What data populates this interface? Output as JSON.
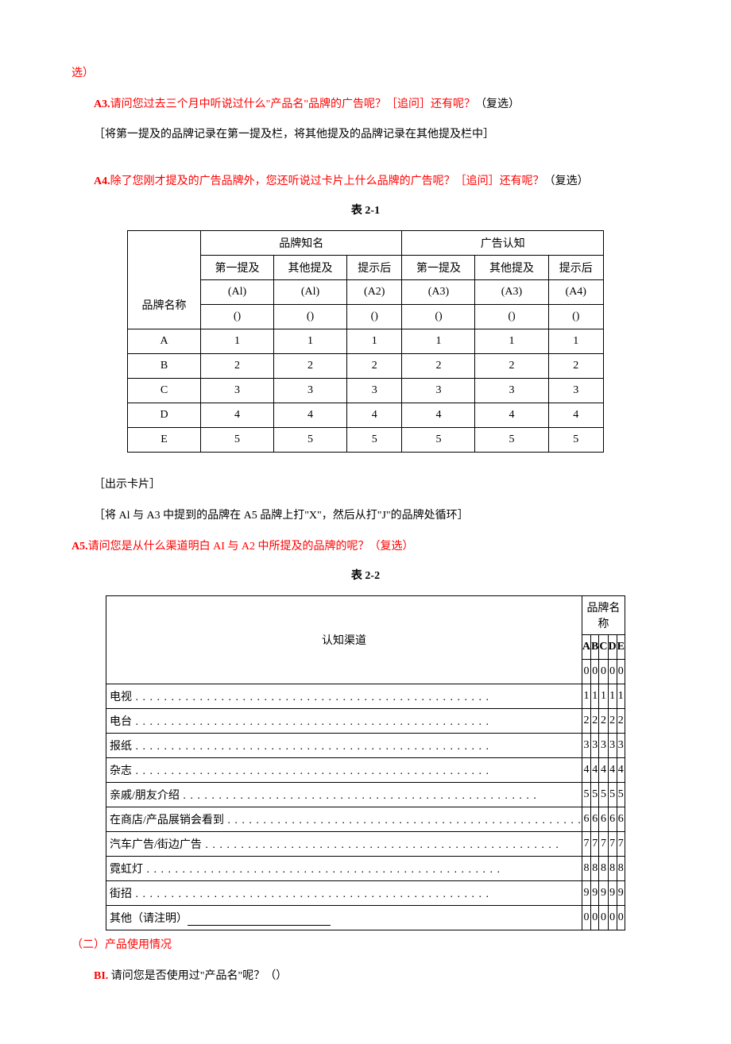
{
  "top_fragment": "选）",
  "q_a3": {
    "label": "A3.",
    "text": "请问您过去三个月中听说过什么\"产品名\"品牌的广告呢？［追问］还有呢？",
    "suffix": "（复选）",
    "note": "［将第一提及的品牌记录在第一提及栏，将其他提及的品牌记录在其他提及栏中］"
  },
  "q_a4": {
    "label": "A4.",
    "text": "除了您刚才提及的广告品牌外，您还听说过卡片上什么品牌的广告呢？［追问］还有呢？",
    "suffix": "（复选）"
  },
  "table1": {
    "caption": "表 2-1",
    "group_headers": [
      "品牌知名",
      "广告认知"
    ],
    "sub_headers": [
      "第一提及",
      "其他提及",
      "提示后",
      "第一提及",
      "其他提及",
      "提示后"
    ],
    "code_row": [
      "(Al)",
      "(Al)",
      "(A2)",
      "(A3)",
      "(A3)",
      "(A4)"
    ],
    "paren_row": [
      "()",
      "()",
      "()",
      "()",
      "()",
      "()"
    ],
    "row_label": "品牌名称",
    "rows": [
      {
        "name": "A",
        "v": [
          "1",
          "1",
          "1",
          "1",
          "1",
          "1"
        ]
      },
      {
        "name": "B",
        "v": [
          "2",
          "2",
          "2",
          "2",
          "2",
          "2"
        ]
      },
      {
        "name": "C",
        "v": [
          "3",
          "3",
          "3",
          "3",
          "3",
          "3"
        ]
      },
      {
        "name": "D",
        "v": [
          "4",
          "4",
          "4",
          "4",
          "4",
          "4"
        ]
      },
      {
        "name": "E",
        "v": [
          "5",
          "5",
          "5",
          "5",
          "5",
          "5"
        ]
      }
    ]
  },
  "mid_notes": {
    "n1": "［出示卡片］",
    "n2": "［将 Al 与 A3 中提到的品牌在 A5 品牌上打\"X\"，然后从打\"J\"的品牌处循环］"
  },
  "q_a5": {
    "label": "A5.",
    "text": "请问您是从什么渠道明白 AI 与 A2 中所提及的品牌的呢？（复选）"
  },
  "table2": {
    "caption": "表 2-2",
    "left_header": "认知渠道",
    "right_header": "品牌名称",
    "brand_cols": [
      "A",
      "B",
      "C",
      "D",
      "E"
    ],
    "brand_zero": [
      "0",
      "0",
      "0",
      "0",
      "0"
    ],
    "rows": [
      {
        "name": "电视",
        "v": [
          "1",
          "1",
          "1",
          "1",
          "1"
        ],
        "dots": true
      },
      {
        "name": "电台",
        "v": [
          "2",
          "2",
          "2",
          "2",
          "2"
        ],
        "dots": true
      },
      {
        "name": "报纸",
        "v": [
          "3",
          "3",
          "3",
          "3",
          "3"
        ],
        "dots": true
      },
      {
        "name": "杂志",
        "v": [
          "4",
          "4",
          "4",
          "4",
          "4"
        ],
        "dots": true
      },
      {
        "name": "亲戚/朋友介绍",
        "v": [
          "5",
          "5",
          "5",
          "5",
          "5"
        ],
        "dots": true
      },
      {
        "name": "在商店/产品展销会看到",
        "v": [
          "6",
          "6",
          "6",
          "6",
          "6"
        ],
        "dots": true
      },
      {
        "name": "汽车广告/街边广告",
        "v": [
          "7",
          "7",
          "7",
          "7",
          "7"
        ],
        "dots": true
      },
      {
        "name": "霓虹灯",
        "v": [
          "8",
          "8",
          "8",
          "8",
          "8"
        ],
        "dots": true
      },
      {
        "name": "街招",
        "v": [
          "9",
          "9",
          "9",
          "9",
          "9"
        ],
        "dots": true
      },
      {
        "name": "其他（请注明）",
        "v": [
          "0",
          "0",
          "0",
          "0",
          "0"
        ],
        "dots": false,
        "underline": true
      }
    ]
  },
  "section2": "（二）产品使用情况",
  "q_b1": {
    "label": "BI.",
    "text": "请问您是否使用过\"产品名\"呢？（）"
  }
}
